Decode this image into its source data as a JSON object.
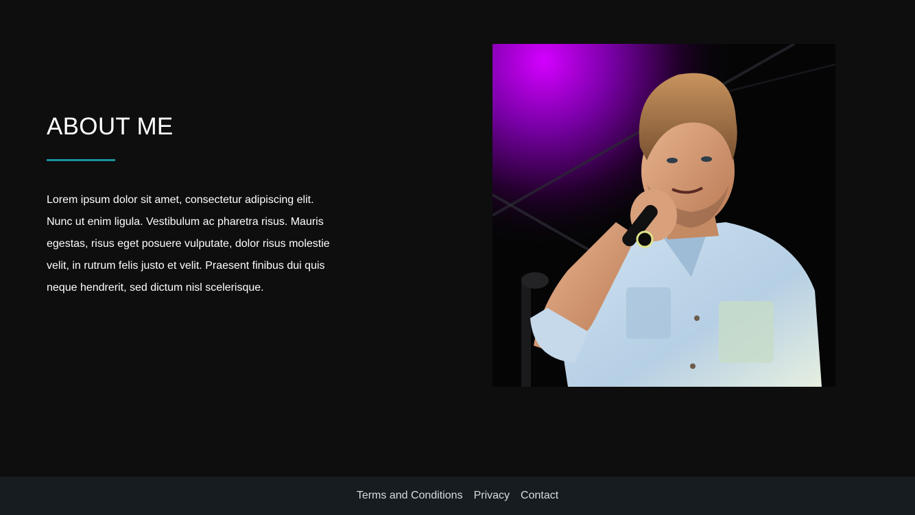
{
  "about": {
    "title": "ABOUT ME",
    "body": "Lorem ipsum dolor sit amet, consectetur adipiscing elit. Nunc ut enim ligula. Vestibulum ac pharetra risus. Mauris egestas, risus eget posuere vulputate, dolor risus molestie velit, in rutrum felis justo et velit. Praesent finibus dui quis neque hendrerit, sed dictum nisl scelerisque.",
    "accent_color": "#17939c"
  },
  "photo": {
    "subject": "man-singing-into-microphone"
  },
  "footer": {
    "links": [
      {
        "label": "Terms and Conditions"
      },
      {
        "label": "Privacy"
      },
      {
        "label": "Contact"
      }
    ]
  }
}
